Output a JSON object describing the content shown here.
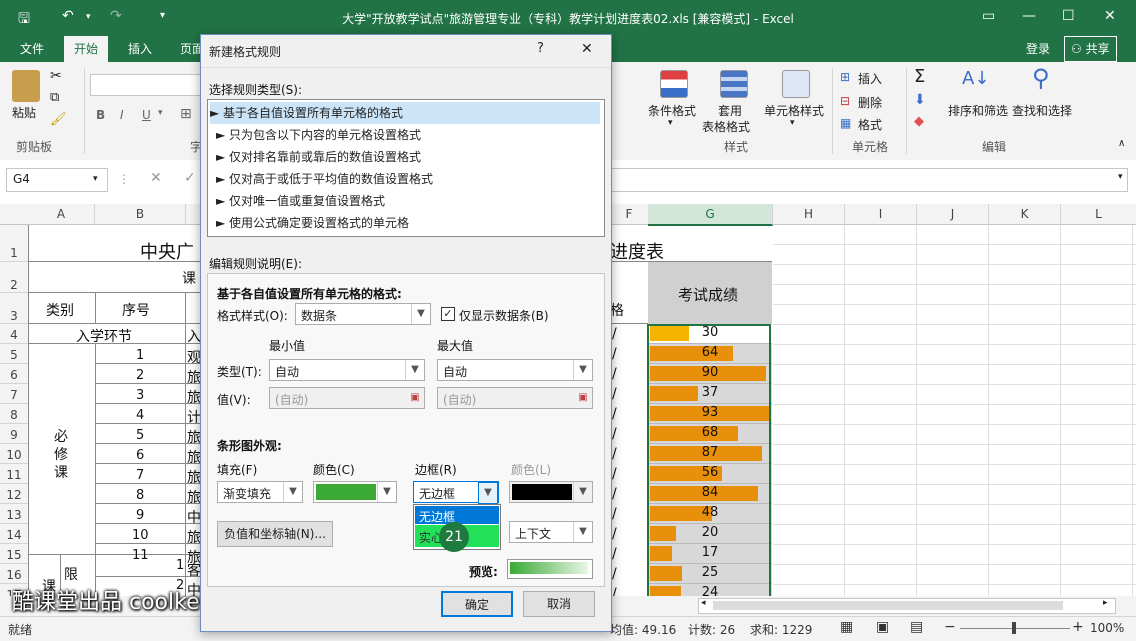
{
  "app": {
    "title": "大学\"开放教学试点\"旅游管理专业（专科）教学计划进度表02.xls  [兼容模式] - Excel"
  },
  "ribbon": {
    "tabs": [
      "文件",
      "开始",
      "插入",
      "页面"
    ],
    "login": "登录",
    "share": "共享",
    "paste_label": "粘贴",
    "clipboard_group": "剪贴板",
    "conditional_format": "条件格式",
    "table_format_1": "套用",
    "table_format_2": "表格格式",
    "cell_style": "单元格样式",
    "styles_group": "样式",
    "insert": "插入",
    "delete": "删除",
    "format": "格式",
    "cells_group": "单元格",
    "sort_filter": "排序和筛选",
    "find_select": "查找和选择",
    "edit_group": "编辑",
    "font_group_partial": "字"
  },
  "formula_bar": {
    "name_box": "G4"
  },
  "sheet": {
    "columns": [
      "A",
      "B",
      "G",
      "H",
      "I",
      "J",
      "K",
      "L"
    ],
    "col_f_partial": "F",
    "rows": [
      "1",
      "2",
      "3",
      "4",
      "5",
      "6",
      "7",
      "8",
      "9",
      "10",
      "11",
      "12",
      "13",
      "14",
      "15",
      "16",
      "17"
    ],
    "title_left": "中央广",
    "title_right": "进度表",
    "row2_text": "课",
    "header_category": "类别",
    "header_seq": "序号",
    "header_grade": "考试成绩",
    "header_f_partial": "格",
    "row4_label": "入学环节",
    "row4_b_partial": "入",
    "bixiu_1": "必",
    "bixiu_2": "修",
    "bixiu_3": "课",
    "xian": "限",
    "ke": "课",
    "seq_numbers": [
      "1",
      "2",
      "3",
      "4",
      "5",
      "6",
      "7",
      "8",
      "9",
      "10",
      "11",
      "1",
      "2"
    ],
    "c_partial": [
      "观",
      "旅",
      "旅",
      "计",
      "旅",
      "旅",
      "旅",
      "旅",
      "中",
      "旅",
      "旅",
      "客",
      "中"
    ],
    "f_mark": "/",
    "scores": [
      30,
      64,
      90,
      37,
      93,
      68,
      87,
      56,
      84,
      48,
      20,
      17,
      25,
      24
    ]
  },
  "dialog": {
    "title": "新建格式规则",
    "help": "?",
    "close": "✕",
    "rule_type_label": "选择规则类型(S):",
    "rule_types": [
      "► 基于各自值设置所有单元格的格式",
      "► 只为包含以下内容的单元格设置格式",
      "► 仅对排名靠前或靠后的数值设置格式",
      "► 仅对高于或低于平均值的数值设置格式",
      "► 仅对唯一值或重复值设置格式",
      "► 使用公式确定要设置格式的单元格"
    ],
    "edit_desc_label": "编辑规则说明(E):",
    "section_title": "基于各自值设置所有单元格的格式:",
    "format_style_label": "格式样式(O):",
    "format_style_value": "数据条",
    "show_bar_only": "仅显示数据条(B)",
    "min_label": "最小值",
    "max_label": "最大值",
    "type_label": "类型(T):",
    "value_label": "值(V):",
    "min_type": "自动",
    "max_type": "自动",
    "min_value": "(自动)",
    "max_value": "(自动)",
    "bar_appearance": "条形图外观:",
    "fill_label": "填充(F)",
    "color_label": "颜色(C)",
    "border_label": "边框(R)",
    "border_color_label": "颜色(L)",
    "fill_value": "渐变填充",
    "border_value": "无边框",
    "border_options": [
      "无边框",
      "实心边框"
    ],
    "direction_value": "上下文",
    "neg_axis_button": "负值和坐标轴(N)...",
    "preview_label": "预览:",
    "ok": "确定",
    "cancel": "取消",
    "fill_color": "#3aaa35",
    "border_color": "#000000"
  },
  "status": {
    "ready": "就绪",
    "avg": "均值: 49.16",
    "count": "计数: 26",
    "sum": "求和: 1229",
    "zoom": "100%"
  },
  "overlay": {
    "click_number": "21",
    "watermark": "酷课堂出品 coolketang.com"
  }
}
